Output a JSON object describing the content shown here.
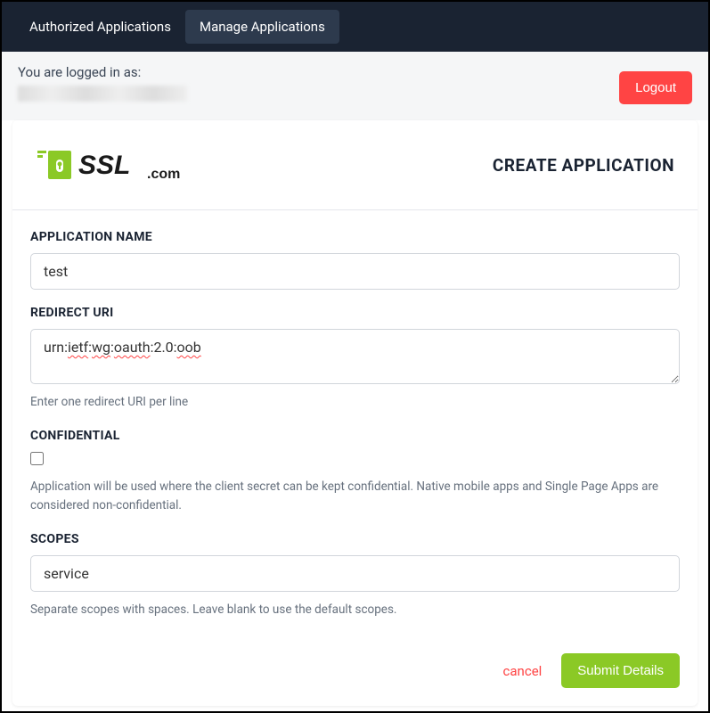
{
  "nav": {
    "tabs": [
      {
        "label": "Authorized Applications",
        "active": false
      },
      {
        "label": "Manage Applications",
        "active": true
      }
    ]
  },
  "user_bar": {
    "logged_in_text": "You are logged in as:",
    "logout_label": "Logout"
  },
  "header": {
    "logo_text_main": "SSL",
    "logo_text_suffix": ".com",
    "page_title": "CREATE APPLICATION"
  },
  "form": {
    "app_name": {
      "label": "APPLICATION NAME",
      "value": "test"
    },
    "redirect_uri": {
      "label": "REDIRECT URI",
      "value": "urn:ietf:wg:oauth:2.0:oob",
      "help": "Enter one redirect URI per line"
    },
    "confidential": {
      "label": "CONFIDENTIAL",
      "checked": false,
      "help": "Application will be used where the client secret can be kept confidential. Native mobile apps and Single Page Apps are considered non-confidential."
    },
    "scopes": {
      "label": "SCOPES",
      "value": "service",
      "help": "Separate scopes with spaces. Leave blank to use the default scopes."
    },
    "cancel_label": "cancel",
    "submit_label": "Submit Details"
  }
}
